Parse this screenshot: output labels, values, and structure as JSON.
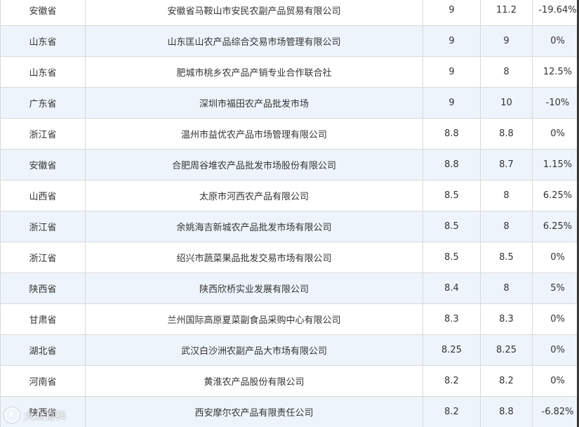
{
  "table": {
    "rows": [
      {
        "province": "安徽省",
        "market": "安徽省马鞍山市安民农副产品贸易有限公司",
        "price_today": "9",
        "price_prev": "11.2",
        "change": "-19.64%"
      },
      {
        "province": "山东省",
        "market": "山东匡山农产品综合交易市场管理有限公司",
        "price_today": "9",
        "price_prev": "9",
        "change": "0%"
      },
      {
        "province": "山东省",
        "market": "肥城市桃乡农产品产销专业合作联合社",
        "price_today": "9",
        "price_prev": "8",
        "change": "12.5%"
      },
      {
        "province": "广东省",
        "market": "深圳市福田农产品批发市场",
        "price_today": "9",
        "price_prev": "10",
        "change": "-10%"
      },
      {
        "province": "浙江省",
        "market": "温州市益优农产品市场管理有限公司",
        "price_today": "8.8",
        "price_prev": "8.8",
        "change": "0%"
      },
      {
        "province": "安徽省",
        "market": "合肥周谷堆农产品批发市场股份有限公司",
        "price_today": "8.8",
        "price_prev": "8.7",
        "change": "1.15%"
      },
      {
        "province": "山西省",
        "market": "太原市河西农产品有限公司",
        "price_today": "8.5",
        "price_prev": "8",
        "change": "6.25%"
      },
      {
        "province": "浙江省",
        "market": "余姚海吉新城农产品批发市场有限公司",
        "price_today": "8.5",
        "price_prev": "8",
        "change": "6.25%"
      },
      {
        "province": "浙江省",
        "market": "绍兴市蔬菜果品批发交易市场有限公司",
        "price_today": "8.5",
        "price_prev": "8.5",
        "change": "0%"
      },
      {
        "province": "陕西省",
        "market": "陕西欣桥实业发展有限公司",
        "price_today": "8.4",
        "price_prev": "8",
        "change": "5%"
      },
      {
        "province": "甘肃省",
        "market": "兰州国际高原夏菜副食品采购中心有限公司",
        "price_today": "8.3",
        "price_prev": "8.3",
        "change": "0%"
      },
      {
        "province": "湖北省",
        "market": "武汉白沙洲农副产品大市场有限公司",
        "price_today": "8.25",
        "price_prev": "8.25",
        "change": "0%"
      },
      {
        "province": "河南省",
        "market": "黄淮农产品股份有限公司",
        "price_today": "8.2",
        "price_prev": "8.2",
        "change": "0%"
      },
      {
        "province": "陕西省",
        "market": "西安摩尔农产品有限责任公司",
        "price_today": "8.2",
        "price_prev": "8.8",
        "change": "-6.82%"
      }
    ]
  },
  "watermark": {
    "text": "大众百科"
  },
  "colors": {
    "alt_row": "#eef4fb",
    "border": "#d9d9d9",
    "text": "#333333"
  }
}
